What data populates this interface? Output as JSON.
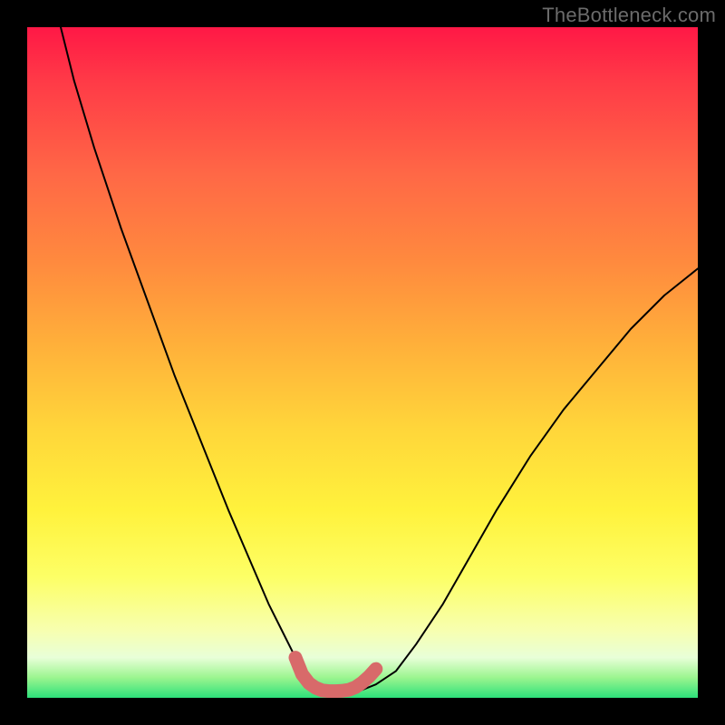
{
  "watermark": "TheBottleneck.com",
  "chart_data": {
    "type": "line",
    "title": "",
    "xlabel": "",
    "ylabel": "",
    "xlim": [
      0,
      100
    ],
    "ylim": [
      0,
      100
    ],
    "grid": false,
    "legend": false,
    "series": [
      {
        "name": "curve",
        "color": "#000000",
        "x": [
          5,
          7,
          10,
          14,
          18,
          22,
          26,
          30,
          33,
          36,
          38,
          40,
          42,
          44,
          46,
          48,
          50,
          52,
          55,
          58,
          62,
          66,
          70,
          75,
          80,
          85,
          90,
          95,
          100
        ],
        "y": [
          100,
          92,
          82,
          70,
          59,
          48,
          38,
          28,
          21,
          14,
          10,
          6,
          3,
          1.5,
          1,
          1,
          1.2,
          2,
          4,
          8,
          14,
          21,
          28,
          36,
          43,
          49,
          55,
          60,
          64
        ]
      },
      {
        "name": "minimum-marker",
        "color": "#d86a6a",
        "x": [
          40,
          41,
          42,
          43,
          44,
          45,
          46,
          47,
          48,
          49,
          50,
          51,
          52
        ],
        "y": [
          6,
          3.5,
          2.2,
          1.5,
          1.1,
          1,
          1,
          1.05,
          1.2,
          1.6,
          2.3,
          3.2,
          4.3
        ]
      }
    ],
    "gradient_stops": [
      {
        "pos": 0,
        "color": "#ff1846"
      },
      {
        "pos": 22,
        "color": "#ff6846"
      },
      {
        "pos": 48,
        "color": "#ffb23a"
      },
      {
        "pos": 72,
        "color": "#fff23c"
      },
      {
        "pos": 90,
        "color": "#f7ffb0"
      },
      {
        "pos": 100,
        "color": "#2de07a"
      }
    ]
  }
}
